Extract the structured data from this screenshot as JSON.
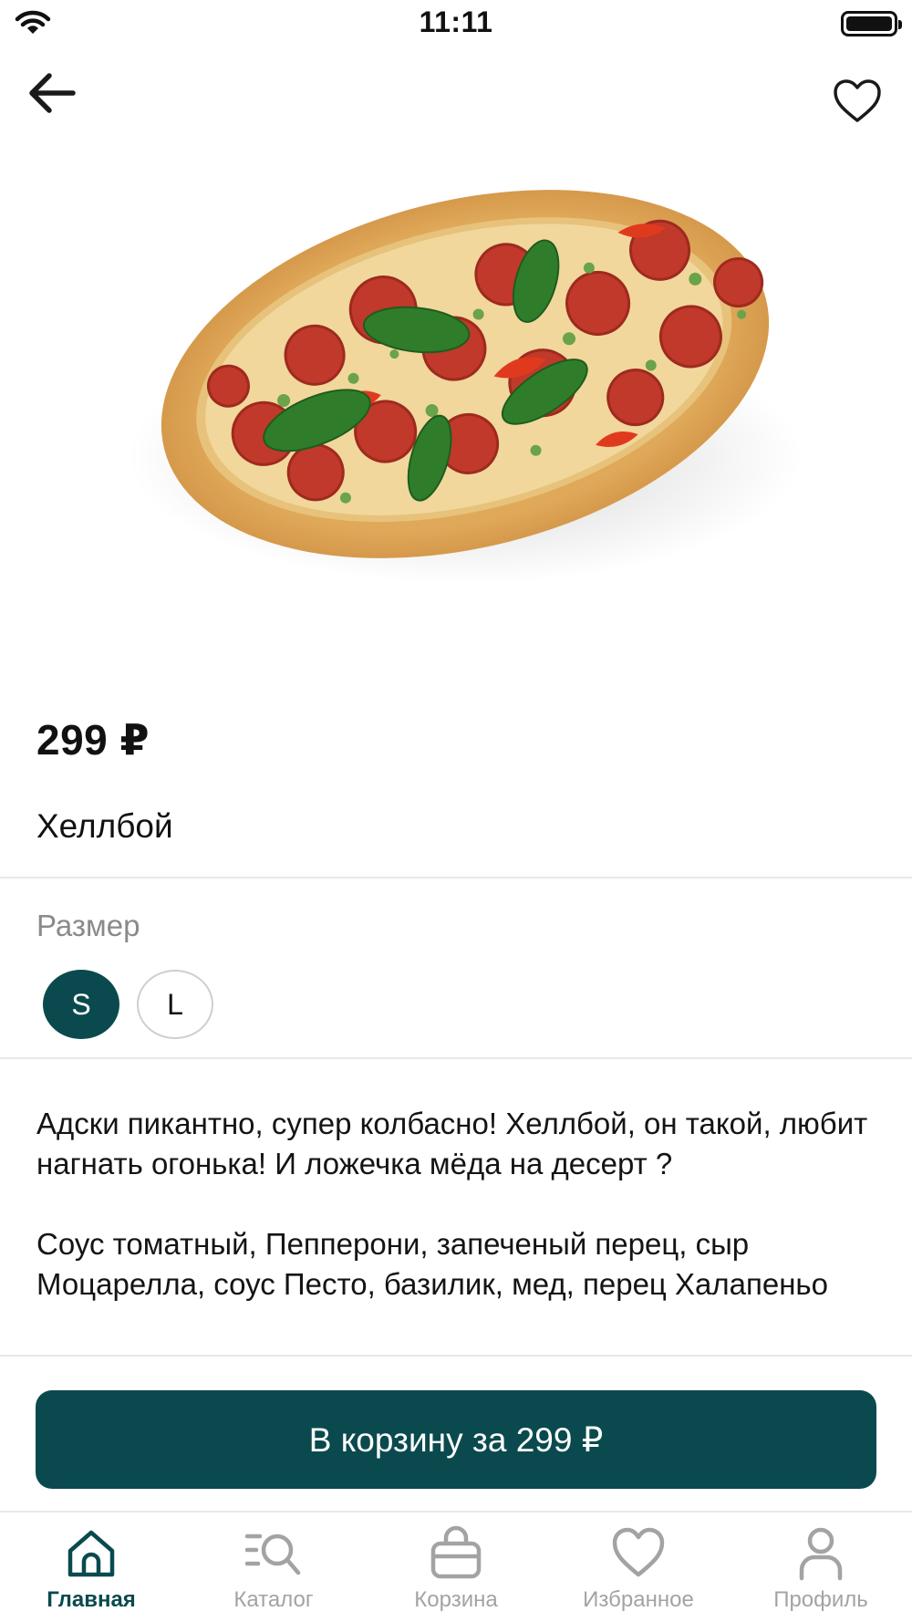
{
  "status_bar": {
    "time": "11:11"
  },
  "product": {
    "price": "299 ₽",
    "name": "Хеллбой",
    "size_label": "Размер",
    "sizes": [
      {
        "label": "S",
        "selected": true
      },
      {
        "label": "L",
        "selected": false
      }
    ],
    "description": "Адски пикантно, супер колбасно! Хеллбой, он такой, любит нагнать огонька! И ложечка мёда на десерт ?",
    "ingredients": "Соус томатный, Пепперони, запеченый перец, сыр Моцарелла, соус Песто, базилик, мед, перец Халапеньо"
  },
  "cart_button": {
    "label": "В корзину за 299 ₽"
  },
  "tab_bar": {
    "items": [
      {
        "label": "Главная",
        "icon": "home-icon",
        "active": true
      },
      {
        "label": "Каталог",
        "icon": "catalog-search-icon",
        "active": false
      },
      {
        "label": "Корзина",
        "icon": "bag-icon",
        "active": false
      },
      {
        "label": "Избранное",
        "icon": "heart-icon",
        "active": false
      },
      {
        "label": "Профиль",
        "icon": "profile-icon",
        "active": false
      }
    ]
  },
  "colors": {
    "accent": "#0a4a4e",
    "tab_inactive": "#a3a3a3",
    "divider": "#e8e8e8"
  }
}
